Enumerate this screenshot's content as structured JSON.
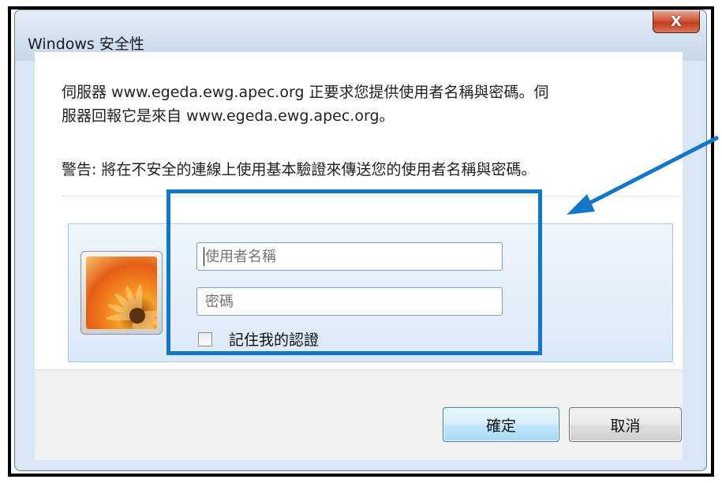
{
  "window": {
    "title": "Windows 安全性",
    "close_glyph": "X"
  },
  "dialog": {
    "message_line1": "伺服器 www.egeda.ewg.apec.org 正要求您提供使用者名稱與密碼。伺",
    "message_line2": "服器回報它是來自 www.egeda.ewg.apec.org。",
    "warning": "警告: 將在不安全的連線上使用基本驗證來傳送您的使用者名稱與密碼。"
  },
  "credentials": {
    "username_placeholder": "使用者名稱",
    "password_placeholder": "密碼",
    "remember_label": "記住我的認證",
    "remember_checked": false
  },
  "buttons": {
    "ok_label": "確定",
    "cancel_label": "取消"
  },
  "colors": {
    "annotation": "#1376c7",
    "close_button": "#c13b1f"
  },
  "icons": {
    "avatar": "user-tile-icon",
    "close": "close-icon",
    "annotation_arrow": "arrow-icon"
  }
}
